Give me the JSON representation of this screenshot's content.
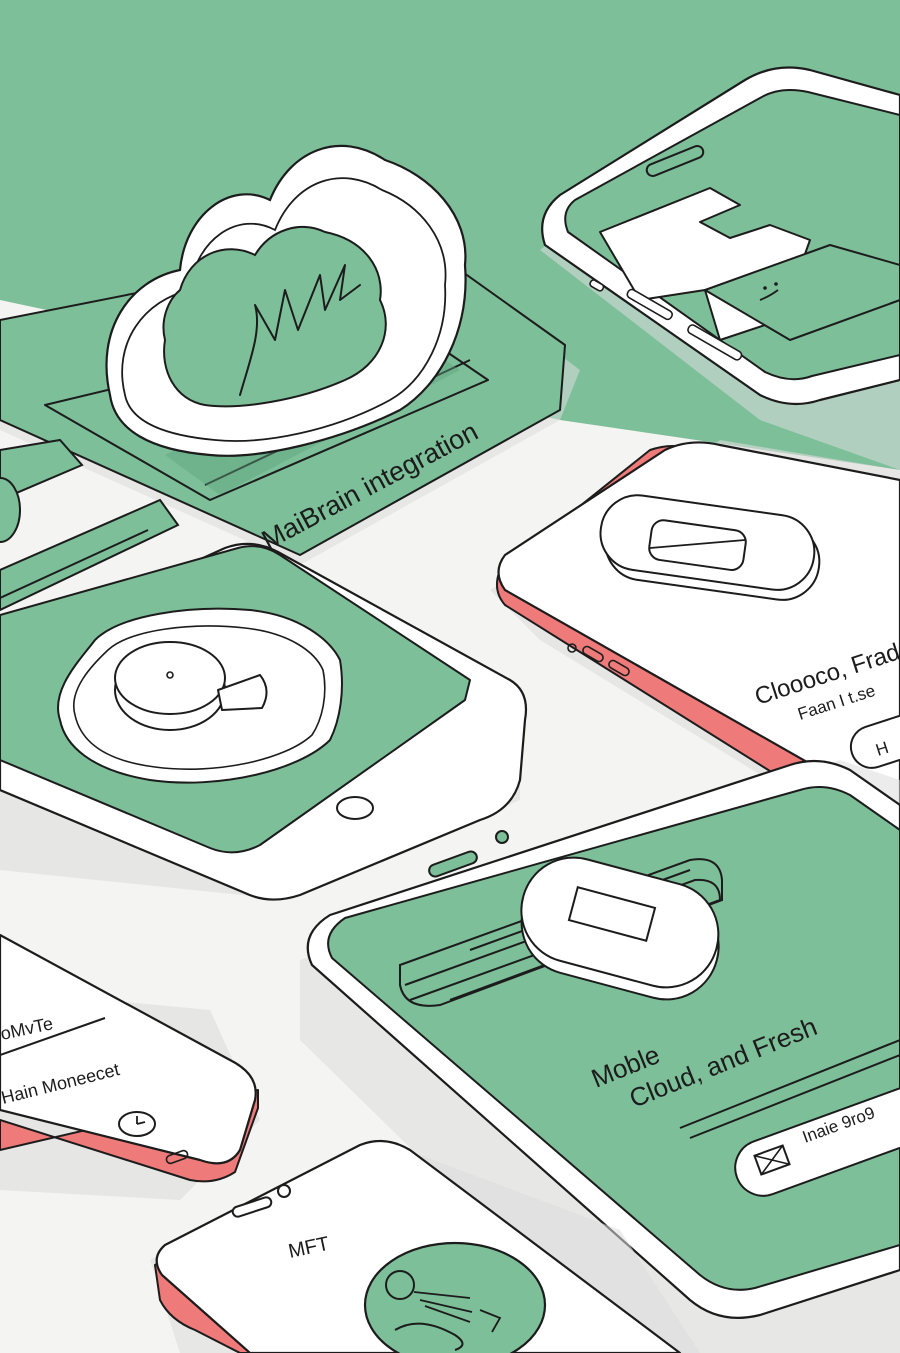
{
  "colors": {
    "background": "#f4f4f2",
    "green": "#7dbf99",
    "white": "#ffffff",
    "line": "#1c1c1c",
    "shadow": "#dcdcdc",
    "coral": "#ef7a7a"
  },
  "labels": {
    "integration": "MaiBrain integration",
    "right_phone_line1": "Cloooco, Frade",
    "right_phone_line2": "Faan I t.se",
    "right_phone_button": "H",
    "main_phone_line1": "Moble",
    "main_phone_line2": "Cloud, and Fresh",
    "main_phone_pill": "Inaie 9ro9",
    "left_phone_line1": "oMvTe",
    "left_phone_line2": "Hain Moneecet",
    "bottom_phone_title": "MFT"
  },
  "icons": {
    "cloud": "cloud-icon",
    "mail": "mail-icon",
    "clock": "clock-icon",
    "smiley": "smiley-face-icon",
    "person": "person-icon"
  }
}
